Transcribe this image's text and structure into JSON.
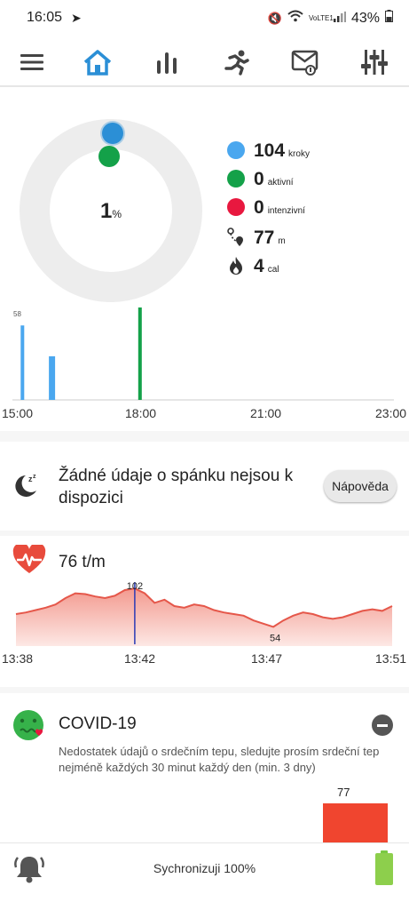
{
  "status_bar": {
    "time": "16:05",
    "battery": "43%",
    "network_label": "VoLTE1"
  },
  "toolbar": {
    "items": [
      "menu-icon",
      "home-icon",
      "stats-icon",
      "run-icon",
      "message-icon",
      "settings-icon"
    ],
    "active_index": 1,
    "accent": "#2b8fd6"
  },
  "summary": {
    "percent_value": "1",
    "percent_symbol": "%",
    "progress_fraction": 0.01,
    "stats": [
      {
        "icon": "blue-dot",
        "color": "#4aa7ef",
        "value": "104",
        "unit": "kroky"
      },
      {
        "icon": "green-dot",
        "color": "#14a149",
        "value": "0",
        "unit": "aktivní"
      },
      {
        "icon": "red-dot",
        "color": "#e8183f",
        "value": "0",
        "unit": "intenzivní"
      },
      {
        "icon": "distance-icon",
        "value": "77",
        "unit": "m"
      },
      {
        "icon": "flame-icon",
        "value": "4",
        "unit": "cal"
      }
    ]
  },
  "chart_data": [
    {
      "type": "bar",
      "x_ticks": [
        "15:00",
        "18:00",
        "21:00",
        "23:00"
      ],
      "x_range_hours": [
        15,
        23
      ],
      "max_label": "58",
      "series": [
        {
          "color": "#4aa7ef",
          "points": [
            {
              "x": 15.1,
              "value": 58
            },
            {
              "x": 15.7,
              "value": 34
            }
          ]
        },
        {
          "color": "#14a149",
          "points": [
            {
              "x": 17.6,
              "value": 72
            }
          ]
        }
      ]
    },
    {
      "type": "area",
      "x_ticks": [
        "13:38",
        "13:42",
        "13:47",
        "13:51"
      ],
      "marker_time": "13:42",
      "max_label": "102",
      "min_label": "54",
      "values": [
        70,
        72,
        75,
        78,
        82,
        90,
        96,
        95,
        92,
        90,
        93,
        100,
        102,
        96,
        84,
        88,
        80,
        78,
        82,
        80,
        75,
        72,
        70,
        68,
        62,
        58,
        54,
        62,
        68,
        72,
        70,
        66,
        64,
        66,
        70,
        74,
        76,
        74,
        80
      ],
      "y_range": [
        30,
        110
      ]
    }
  ],
  "sleep": {
    "text": "Žádné údaje o spánku nejsou k dispozici",
    "help_button": "Nápověda"
  },
  "heart": {
    "rate": "76 t/m"
  },
  "covid": {
    "title": "COVID-19",
    "description": "Nedostatek údajů o srdečním tepu, sledujte prosím srdeční tep nejméně každých 30 minut každý den (min. 3 dny)",
    "bar_value": "77"
  },
  "bottom": {
    "sync_text": "Sychronizuji 100%"
  }
}
